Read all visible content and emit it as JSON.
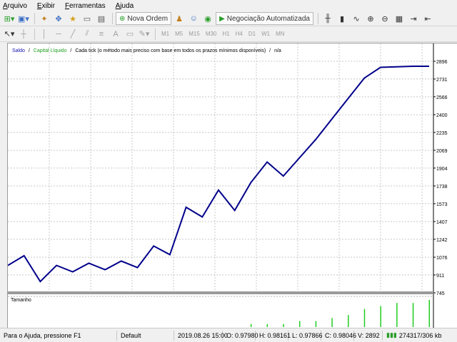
{
  "menu": [
    {
      "first": "A",
      "rest": "rquivo"
    },
    {
      "first": "E",
      "rest": "xibir"
    },
    {
      "first": "F",
      "rest": "erramentas"
    },
    {
      "first": "A",
      "rest": "juda"
    }
  ],
  "toolbar": {
    "new_order_label": "Nova Ordem",
    "auto_trading_label": "Negociação Automatizada",
    "timeframes": [
      "M1",
      "M5",
      "M15",
      "M30",
      "H1",
      "H4",
      "D1",
      "W1",
      "MN"
    ]
  },
  "chart_header": {
    "balance_label": "Saldo",
    "equity_label": "Capital Líquido",
    "description": "Cada tick (o método mais preciso com base em todos os prazos mínimos disponíveis)",
    "na": "n/a",
    "sep": "/"
  },
  "colors": {
    "balance": "#00008b",
    "balance_label": "#1010b0",
    "equity_label": "#20a020",
    "volume_bar": "#22cc22"
  },
  "chart_data": {
    "type": "line",
    "title": "",
    "xlabel": "",
    "ylabel": "",
    "y_ticks": [
      2896,
      2731,
      2566,
      2400,
      2235,
      2069,
      1904,
      1738,
      1573,
      1407,
      1242,
      1076,
      911,
      745
    ],
    "ylim": [
      745,
      2896
    ],
    "grid": true,
    "series": [
      {
        "name": "Saldo",
        "x": [
          0,
          1,
          2,
          3,
          4,
          5,
          6,
          7,
          8,
          9,
          10,
          11,
          12,
          13,
          14,
          15,
          16,
          17,
          18,
          19,
          20,
          21,
          22,
          23,
          24,
          25,
          26
        ],
        "values": [
          1000,
          1090,
          850,
          1000,
          940,
          1020,
          960,
          1040,
          980,
          1180,
          1100,
          1540,
          1450,
          1700,
          1510,
          1770,
          1960,
          1830,
          2000,
          2170,
          2360,
          2550,
          2740,
          2840,
          2845,
          2850,
          2850
        ]
      }
    ],
    "volume_label": "Tamanho",
    "volume_values": [
      0,
      0,
      0,
      0,
      0,
      0,
      0,
      0,
      0,
      0,
      0,
      0,
      0,
      0,
      0,
      1,
      1,
      1,
      2,
      2,
      3,
      4,
      6,
      7,
      8,
      8,
      9
    ]
  },
  "status": {
    "help": "Para o Ajuda, pressione F1",
    "profile": "Default",
    "datetime": "2019.08.26 15:00",
    "open": "O: 0.97980",
    "high": "H: 0.98161",
    "low": "L: 0.97866",
    "close": "C: 0.98046",
    "volume": "V: 2892",
    "memory": "274317/306 kb"
  }
}
